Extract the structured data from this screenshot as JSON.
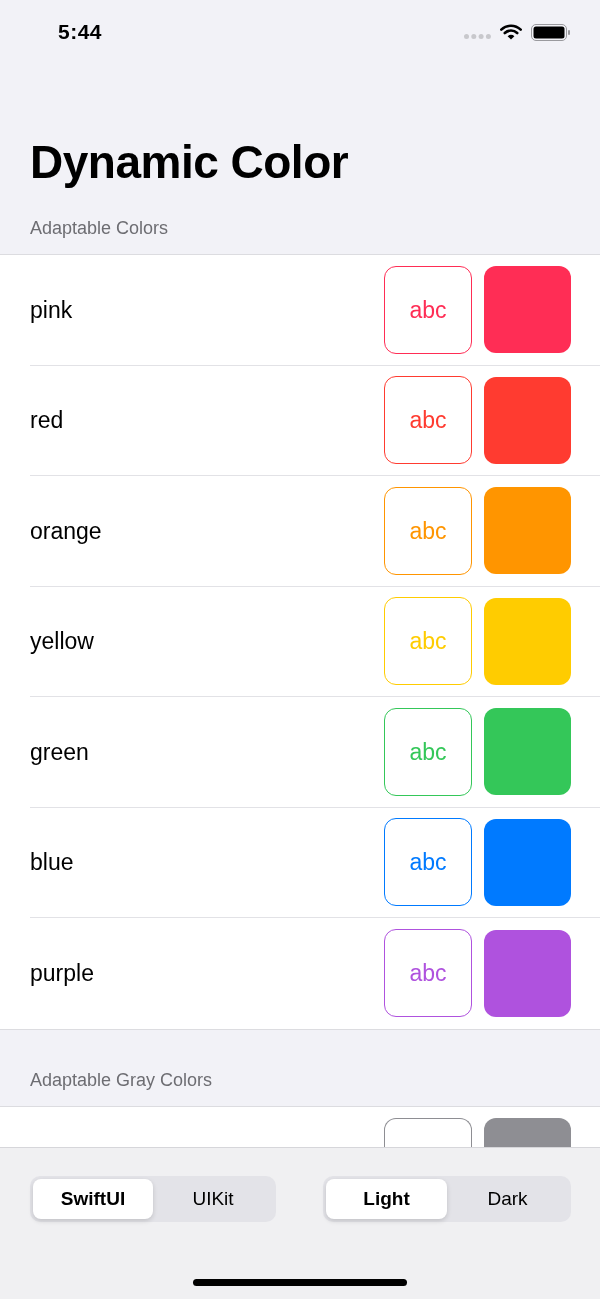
{
  "status_bar": {
    "time": "5:44"
  },
  "title": "Dynamic Color",
  "sections": [
    {
      "header": "Adaptable Colors",
      "rows": [
        {
          "name": "pink",
          "sample": "abc",
          "color": "#ff2d55"
        },
        {
          "name": "red",
          "sample": "abc",
          "color": "#ff3b30"
        },
        {
          "name": "orange",
          "sample": "abc",
          "color": "#ff9500"
        },
        {
          "name": "yellow",
          "sample": "abc",
          "color": "#ffcc00"
        },
        {
          "name": "green",
          "sample": "abc",
          "color": "#34c759"
        },
        {
          "name": "blue",
          "sample": "abc",
          "color": "#007aff"
        },
        {
          "name": "purple",
          "sample": "abc",
          "color": "#af52de"
        }
      ]
    },
    {
      "header": "Adaptable Gray Colors",
      "rows": [
        {
          "color": "#8e8e93"
        }
      ]
    }
  ],
  "toolbar": {
    "segmented_controls": [
      {
        "segments": [
          {
            "label": "SwiftUI",
            "selected": true
          },
          {
            "label": "UIKit",
            "selected": false
          }
        ]
      },
      {
        "segments": [
          {
            "label": "Light",
            "selected": true
          },
          {
            "label": "Dark",
            "selected": false
          }
        ]
      }
    ]
  }
}
